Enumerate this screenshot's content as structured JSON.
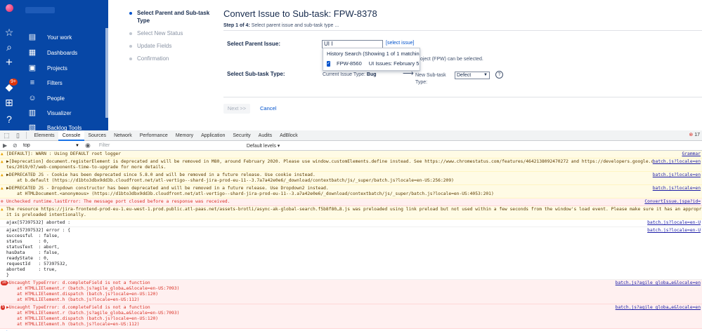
{
  "nav": {
    "items": [
      {
        "label": "Your work",
        "icon": "user-work-icon",
        "glyph": "▤"
      },
      {
        "label": "Dashboards",
        "icon": "dashboard-icon",
        "glyph": "▦"
      },
      {
        "label": "Projects",
        "icon": "projects-icon",
        "glyph": "▣"
      },
      {
        "label": "Filters",
        "icon": "filter-icon",
        "glyph": "≡"
      },
      {
        "label": "People",
        "icon": "people-icon",
        "glyph": "☺"
      },
      {
        "label": "Visualizer",
        "icon": "visualizer-icon",
        "glyph": "▥"
      },
      {
        "label": "Backlog Tools",
        "icon": "backlog-tools-icon",
        "glyph": "▧"
      }
    ],
    "badge": "9+"
  },
  "steps": [
    {
      "label": "Select Parent and Sub-task Type",
      "active": true
    },
    {
      "label": "Select New Status",
      "active": false
    },
    {
      "label": "Update Fields",
      "active": false
    },
    {
      "label": "Confirmation",
      "active": false
    }
  ],
  "wizard": {
    "title": "Convert Issue to Sub-task: FPW-8378",
    "step_prefix": "Step 1 of 4:",
    "step_text": "Select parent issue and sub-task type ...",
    "parent_label": "Select Parent Issue:",
    "parent_value": "UI I",
    "select_issue_link": "[select issue]",
    "dropdown_header": "History Search (Showing 1 of 1 matching",
    "dropdown_key": "FPW-8560",
    "dropdown_summary": "UI Issues: February 5",
    "help_text": "oject (FPW) can be selected.",
    "subtask_label": "Select Sub-task Type:",
    "current_type_prefix": "Current Issue Type:",
    "current_type": "Bug",
    "new_subtask_label": "New Sub-task Type:",
    "new_subtask_value": "Defect",
    "next_label": "Next >>",
    "cancel_label": "Cancel"
  },
  "devtools": {
    "tabs": [
      "Elements",
      "Console",
      "Sources",
      "Network",
      "Performance",
      "Memory",
      "Application",
      "Security",
      "Audits",
      "AdBlock"
    ],
    "active_tab": "Console",
    "error_count": "17",
    "context": "top",
    "filter_placeholder": "Filter",
    "levels": "Default levels ▾",
    "messages": [
      {
        "type": "warn",
        "text": "[DEFAULT]: WARN : Using DEFAULT root logger",
        "source": "Grammar"
      },
      {
        "type": "warn",
        "text": "▶[Deprecation] document.registerElement is deprecated and will be removed in M80, around February 2020. Please use window.customElements.define instead. See https://www.chromestatus.com/features/4642138092470272 and https://developers.google.com/web/upda\ntes/2019/07/web-components-time-to-upgrade for more details.",
        "source": "batch.js?locale=en"
      },
      {
        "type": "warn",
        "text": "▶DEPRECATED JS - Cookie has been deprecated since 5.8.0 and will be removed in a future release. Use cookie instead.\n    at b.default (https://d1bto3dbx9dd3b.cloudfront.net/atl-vertigo--shard-jira-prod-eu-11--3.7a7a42e0e6/_download/contextbatch/js/_super/batch.js?locale=en-US:256:209)",
        "source": "batch.js?locale=en"
      },
      {
        "type": "warn",
        "text": "▶DEPRECATED JS - Dropdown constructor has been deprecated and will be removed in a future release. Use Dropdown2 instead.\n    at HTMLDocument.<anonymous> (https://d1bto3dbx9dd3b.cloudfront.net/atl-vertigo--shard-jira-prod-eu-11--3.a7a42e0e6/_download/contextbatch/js/_super/batch.js?locale=en-US:4053:201)",
        "source": "batch.js?locale=en"
      },
      {
        "type": "err",
        "text": "Unchecked runtime.lastError: The message port closed before a response was received.",
        "source": "ConvertIssue.jspa?id="
      },
      {
        "type": "warn",
        "text": "The resource https://jira-frontend-prod-eu-1.eu-west-1.prod.public.atl-paas.net/assets-brotli/async-ak-global-search.f5b8f80…8.js was preloaded using link preload but not used within a few seconds from the window's load event. Please make sure it has an appropriate `as` va\nit is preloaded intentionally.",
        "source": ""
      },
      {
        "type": "log",
        "text": "ajax[57397532] aborted :",
        "source": "batch.js?locale=en-U"
      },
      {
        "type": "log",
        "text": "ajax[57397532] error : {\nsuccessful  : false,\nstatus      : 0,\nstatusText  : abort,\nhasData     : false,\nreadyState  : 0,\nrequestId   : 57397532,\naborted     : true,\n}",
        "source": "batch.js?locale=en-U"
      },
      {
        "type": "err",
        "count": "16",
        "text": "▶Uncaught TypeError: d.completeField is not a function\n    at HTMLLIElement.r (batch.js?agile_globa…e&locale=en-US:7093)\n    at HTMLLIElement.dispatch (batch.js?locale=en-US:120)\n    at HTMLLIElement.h (batch.js?locale=en-US:112)",
        "source": "batch.js?agile_globa…e&locale=en"
      },
      {
        "type": "err",
        "count": "5",
        "text": "▶Uncaught TypeError: d.completeField is not a function\n    at HTMLLIElement.r (batch.js?agile_globa…e&locale=en-US:7093)\n    at HTMLLIElement.dispatch (batch.js?locale=en-US:120)\n    at HTMLLIElement.h (batch.js?locale=en-US:112)",
        "source": "batch.js?agile_globa…e&locale=en"
      }
    ],
    "prompt": ">"
  }
}
